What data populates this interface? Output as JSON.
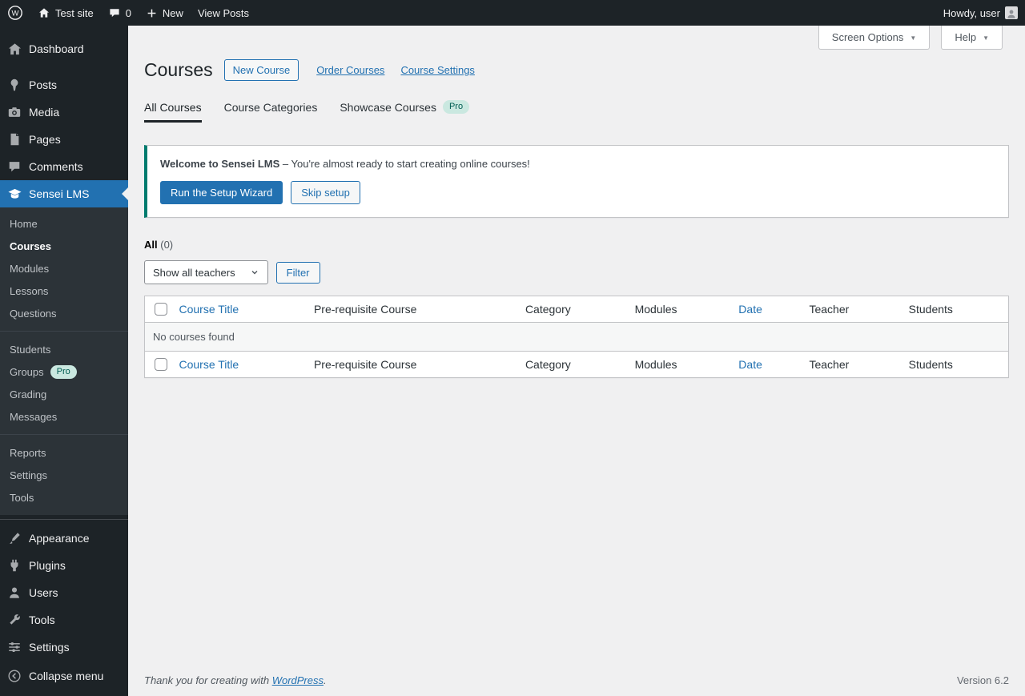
{
  "colors": {
    "accent": "#2271b1",
    "admin_dark": "#1d2327",
    "submenu_bg": "#2c3338",
    "content_bg": "#f0f0f1",
    "notice_border": "#007b6e",
    "pro_badge_bg": "#cae8e0",
    "pro_badge_text": "#015d52"
  },
  "icons": {
    "chevron_down": "▼"
  },
  "admin_bar": {
    "site_name": "Test site",
    "comments_count": "0",
    "new_label": "New",
    "view_posts": "View Posts",
    "howdy": "Howdy, user"
  },
  "sidebar": {
    "dashboard": "Dashboard",
    "posts": "Posts",
    "media": "Media",
    "pages": "Pages",
    "comments": "Comments",
    "sensei": "Sensei LMS",
    "submenu": {
      "home": "Home",
      "courses": "Courses",
      "modules": "Modules",
      "lessons": "Lessons",
      "questions": "Questions",
      "students": "Students",
      "groups": "Groups",
      "groups_badge": "Pro",
      "grading": "Grading",
      "messages": "Messages",
      "reports": "Reports",
      "settings": "Settings",
      "tools": "Tools"
    },
    "appearance": "Appearance",
    "plugins": "Plugins",
    "users": "Users",
    "tools": "Tools",
    "settings": "Settings",
    "collapse": "Collapse menu"
  },
  "toolbar": {
    "screen_options": "Screen Options",
    "help": "Help"
  },
  "page": {
    "title": "Courses",
    "new_course": "New Course",
    "order_courses": "Order Courses",
    "course_settings": "Course Settings",
    "tabs": {
      "all": "All Courses",
      "categories": "Course Categories",
      "showcase": "Showcase Courses",
      "showcase_badge": "Pro"
    }
  },
  "notice": {
    "title": "Welcome to Sensei LMS",
    "text": "– You're almost ready to start creating online courses!",
    "run_wizard": "Run the Setup Wizard",
    "skip": "Skip setup"
  },
  "filters": {
    "all_label": "All",
    "all_count": "(0)",
    "teacher_dropdown": "Show all teachers",
    "filter_button": "Filter"
  },
  "table": {
    "columns": [
      "Course Title",
      "Pre-requisite Course",
      "Category",
      "Modules",
      "Date",
      "Teacher",
      "Students"
    ],
    "empty": "No courses found"
  },
  "footer": {
    "thanks_prefix": "Thank you for creating with",
    "wordpress": "WordPress",
    "thanks_suffix": ".",
    "version": "Version 6.2"
  }
}
